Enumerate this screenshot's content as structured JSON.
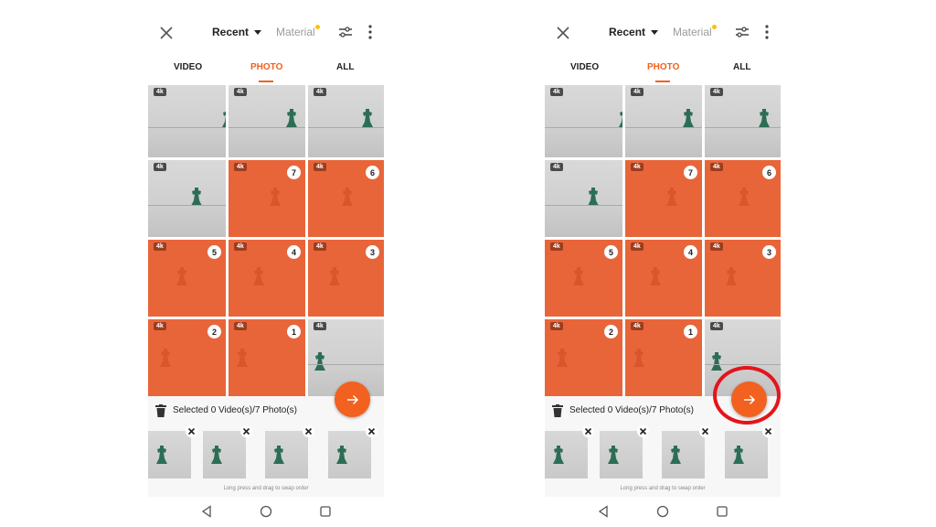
{
  "colors": {
    "accent": "#f2611f",
    "selected_tile": "#e8653a",
    "highlight": "#e3151a",
    "badge_dot": "#ffc107"
  },
  "header": {
    "close_icon": "close-icon",
    "album_label": "Recent",
    "material_label": "Material",
    "filter_icon": "sliders-icon",
    "more_icon": "more-vertical-icon"
  },
  "tabs": [
    {
      "label": "VIDEO"
    },
    {
      "label": "PHOTO",
      "active": true
    },
    {
      "label": "ALL"
    }
  ],
  "grid": {
    "tiles": [
      {
        "badge": "4k",
        "selected": false,
        "order": ""
      },
      {
        "badge": "4k",
        "selected": false,
        "order": ""
      },
      {
        "badge": "4k",
        "selected": false,
        "order": ""
      },
      {
        "badge": "4k",
        "selected": false,
        "order": ""
      },
      {
        "badge": "4k",
        "selected": true,
        "order": "7"
      },
      {
        "badge": "4k",
        "selected": true,
        "order": "6"
      },
      {
        "badge": "4k",
        "selected": true,
        "order": "5"
      },
      {
        "badge": "4k",
        "selected": true,
        "order": "4"
      },
      {
        "badge": "4k",
        "selected": true,
        "order": "3"
      },
      {
        "badge": "4k",
        "selected": true,
        "order": "2"
      },
      {
        "badge": "4k",
        "selected": true,
        "order": "1"
      },
      {
        "badge": "4k",
        "selected": false,
        "order": ""
      }
    ]
  },
  "selection": {
    "summary": "Selected 0 Video(s)/7 Photo(s)",
    "trash_icon": "trash-icon",
    "next_icon": "arrow-right-icon"
  },
  "strip": {
    "thumbnail_count": 4,
    "remove_icon": "close-icon",
    "hint": "Long press and drag to swap order"
  },
  "navbar": {
    "back_icon": "triangle-back-icon",
    "home_icon": "circle-home-icon",
    "recents_icon": "square-recents-icon"
  }
}
